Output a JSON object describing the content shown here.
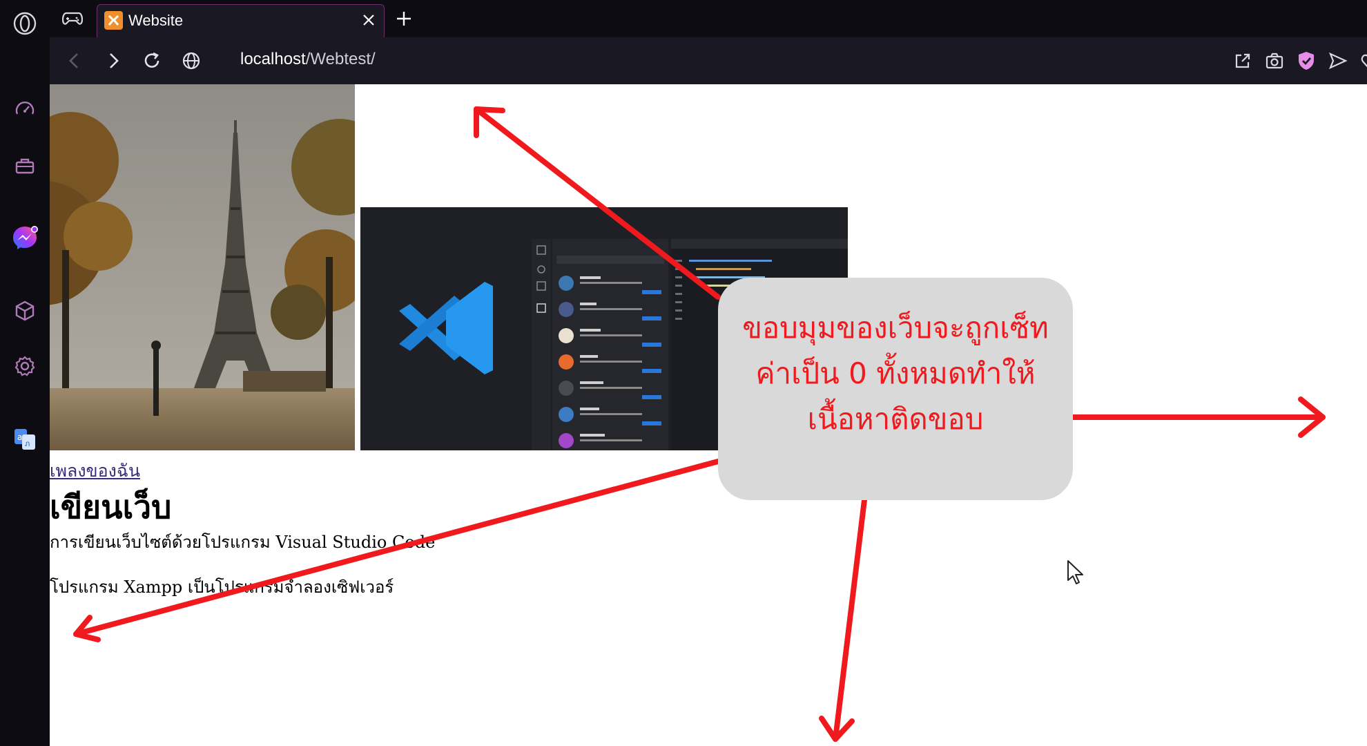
{
  "browser": {
    "tab": {
      "title": "Website"
    },
    "address_bar": {
      "host": "localhost",
      "path": "/Webtest/"
    },
    "sidebar_icons": [
      "speed-dial-icon",
      "briefcase-icon",
      "messenger-icon",
      "cube-icon",
      "settings-icon",
      "translate-icon"
    ],
    "toolbar_icons": [
      "share-icon",
      "camera-icon",
      "vpn-shield-icon",
      "send-icon",
      "heart-icon"
    ],
    "colors": {
      "chrome_dark": "#0d0c12",
      "toolbar": "#1a1822",
      "accent": "#b03ab6",
      "favicon": "#f08f2c"
    }
  },
  "page": {
    "images": [
      "eiffel-tower-photo",
      "vscode-screenshot"
    ],
    "link_text": "เพลงของฉัน",
    "heading": "เขียนเว็บ",
    "paragraph_1": "การเขียนเว็บไซต์ด้วยโปรแกรม Visual Studio Code",
    "paragraph_2": "โปรแกรม Xampp เป็นโปรแกรมจำลองเซิฟเวอร์"
  },
  "annotation": {
    "callout_lines": [
      "ขอบมุมของเว็บจะถูกเซ็ท",
      "ค่าเป็น 0 ทั้งหมดทำให้",
      "เนื้อหาติดขอบ"
    ],
    "arrow_color": "#f0191e",
    "callout_bg": "#d9d9d9"
  }
}
